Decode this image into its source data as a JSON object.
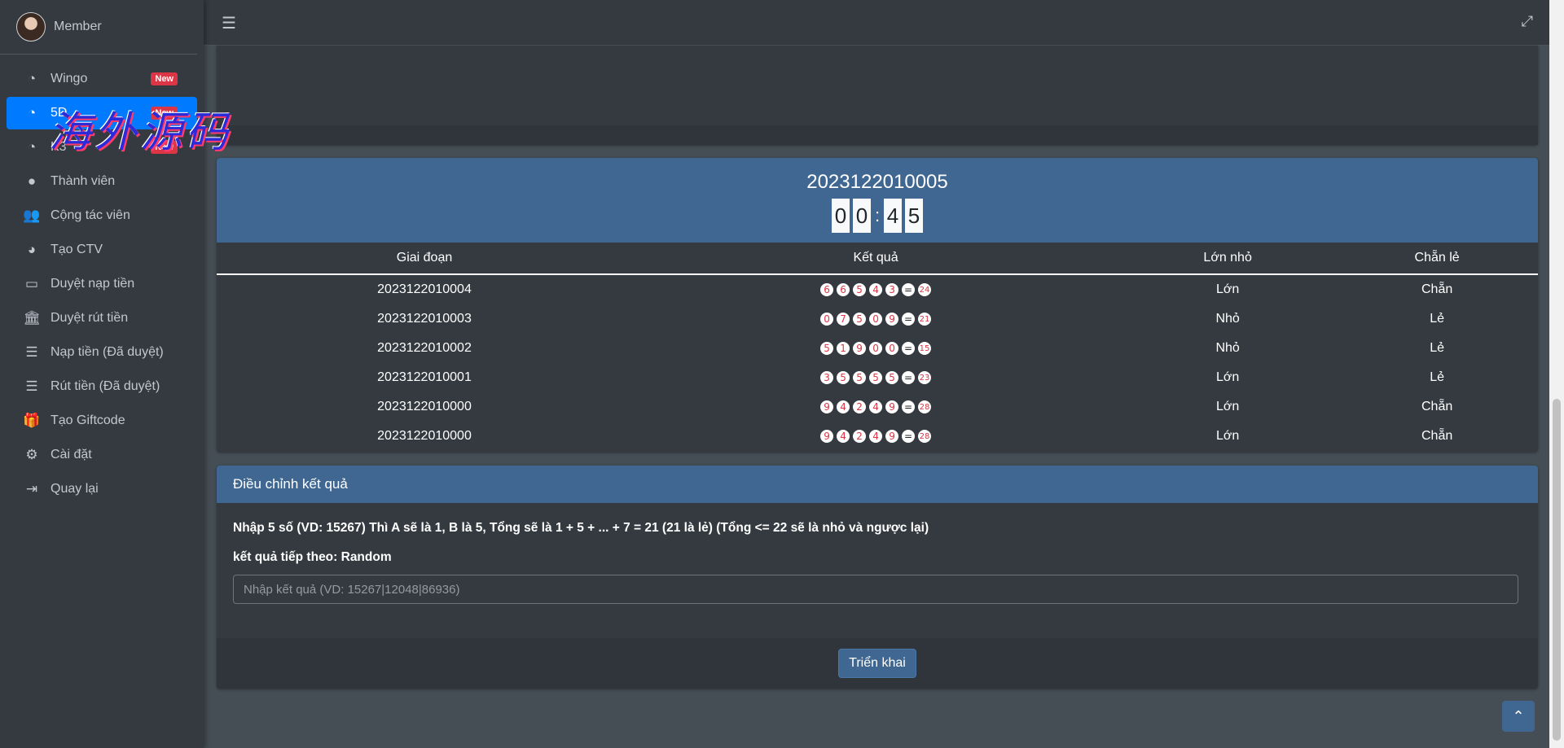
{
  "user": {
    "name": "Member"
  },
  "sidebar": {
    "items": [
      {
        "label": "Wingo",
        "icon": "tachometer-icon",
        "glyph": "◔",
        "badge": "New"
      },
      {
        "label": "5D",
        "icon": "tachometer-icon",
        "glyph": "◔",
        "badge": "New",
        "active": true
      },
      {
        "label": "K3",
        "icon": "tachometer-icon",
        "glyph": "◔",
        "badge": "New"
      },
      {
        "label": "Thành viên",
        "icon": "user-circle-icon",
        "glyph": "●"
      },
      {
        "label": "Cộng tác viên",
        "icon": "users-icon",
        "glyph": "👥"
      },
      {
        "label": "Tạo CTV",
        "icon": "pie-chart-icon",
        "glyph": "◕"
      },
      {
        "label": "Duyệt nạp tiền",
        "icon": "credit-card-icon",
        "glyph": "▭"
      },
      {
        "label": "Duyệt rút tiền",
        "icon": "bank-icon",
        "glyph": "🏛"
      },
      {
        "label": "Nạp tiền (Đã duyệt)",
        "icon": "list-icon",
        "glyph": "☰"
      },
      {
        "label": "Rút tiền (Đã duyệt)",
        "icon": "list-icon",
        "glyph": "☰"
      },
      {
        "label": "Tạo Giftcode",
        "icon": "gift-icon",
        "glyph": "🎁"
      },
      {
        "label": "Cài đặt",
        "icon": "gear-icon",
        "glyph": "⚙"
      },
      {
        "label": "Quay lại",
        "icon": "sign-out-icon",
        "glyph": "⇥"
      }
    ]
  },
  "watermark": "海外源码",
  "game": {
    "period": "2023122010005",
    "timer": [
      "0",
      "0",
      "4",
      "5"
    ],
    "columns": [
      "Giai đoạn",
      "Kết quả",
      "Lớn nhỏ",
      "Chẵn lẻ"
    ],
    "rows": [
      {
        "period": "2023122010004",
        "balls": [
          "6",
          "6",
          "5",
          "4",
          "3"
        ],
        "sum": "24",
        "size": "Lớn",
        "parity": "Chẵn"
      },
      {
        "period": "2023122010003",
        "balls": [
          "0",
          "7",
          "5",
          "0",
          "9"
        ],
        "sum": "21",
        "size": "Nhỏ",
        "parity": "Lẻ"
      },
      {
        "period": "2023122010002",
        "balls": [
          "5",
          "1",
          "9",
          "0",
          "0"
        ],
        "sum": "15",
        "size": "Nhỏ",
        "parity": "Lẻ"
      },
      {
        "period": "2023122010001",
        "balls": [
          "3",
          "5",
          "5",
          "5",
          "5"
        ],
        "sum": "23",
        "size": "Lớn",
        "parity": "Lẻ"
      },
      {
        "period": "2023122010000",
        "balls": [
          "9",
          "4",
          "2",
          "4",
          "9"
        ],
        "sum": "28",
        "size": "Lớn",
        "parity": "Chẵn"
      },
      {
        "period": "2023122010000",
        "balls": [
          "9",
          "4",
          "2",
          "4",
          "9"
        ],
        "sum": "28",
        "size": "Lớn",
        "parity": "Chẵn"
      }
    ]
  },
  "adjust": {
    "title": "Điều chỉnh kết quả",
    "instruction": "Nhập 5 số (VD: 15267) Thì A sẽ là 1, B là 5, Tổng sẽ là 1 + 5 + ... + 7 = 21 (21 là lẻ) (Tổng <= 22 sẽ là nhỏ và ngược lại)",
    "next_label": "kết quả tiếp theo: Random",
    "input_placeholder": "Nhập kết quả (VD: 15267|12048|86936)",
    "button": "Triển khai"
  },
  "colors": {
    "sidebar": "#343a40",
    "body": "#454d55",
    "header_blue": "#3f6791",
    "active": "#007bff",
    "badge": "#dc3545"
  }
}
